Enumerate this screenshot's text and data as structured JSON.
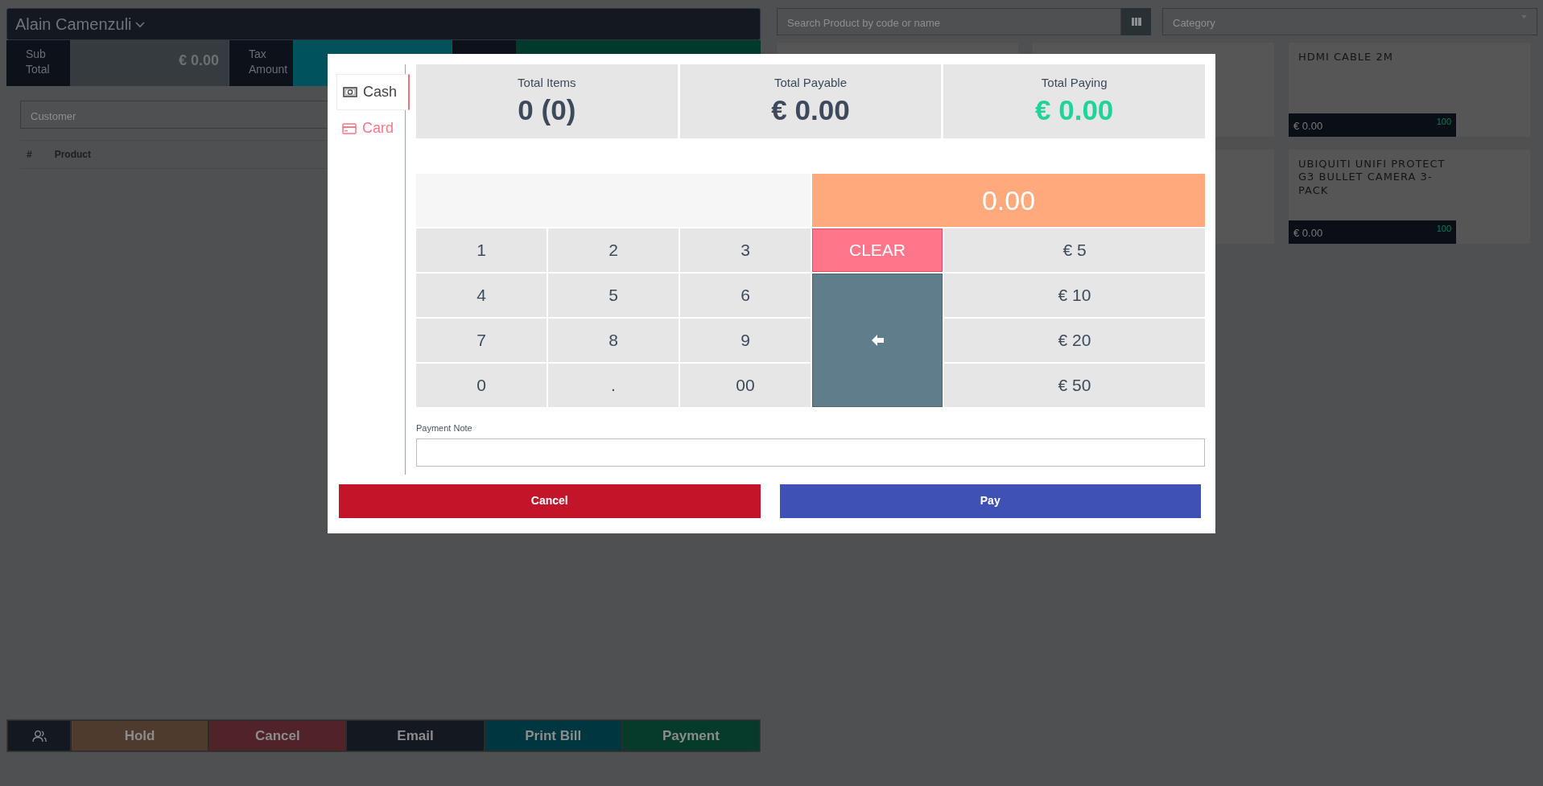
{
  "header": {
    "user": "Alain Camenzuli"
  },
  "totals": [
    {
      "label": "Sub Total",
      "value": "€ 0.00"
    },
    {
      "label": "Tax Amount"
    }
  ],
  "customer": {
    "placeholder": "Customer"
  },
  "cart_table": {
    "columns": [
      "#",
      "Product"
    ]
  },
  "actions": [
    {
      "kind": "icon",
      "color": "#141821"
    },
    {
      "kind": "text",
      "label": "Hold",
      "color": "#4f3a2e"
    },
    {
      "kind": "text",
      "label": "Cancel",
      "color": "#4f2327"
    },
    {
      "kind": "text",
      "label": "Email",
      "color": "#141821"
    },
    {
      "kind": "text",
      "label": "Print Bill",
      "color": "#00363f"
    },
    {
      "kind": "text",
      "label": "Payment",
      "color": "#063a2a"
    }
  ],
  "search": {
    "placeholder": "Search Product by code or name"
  },
  "category": {
    "placeholder": "Category"
  },
  "product_rows": [
    [
      {
        "kind": "covered"
      },
      {
        "kind": "covered"
      },
      {
        "kind": "product",
        "name": "HDMI CABLE 2M",
        "price": "€ 0.00",
        "stock": "100"
      }
    ],
    [
      {
        "kind": "covered"
      },
      {
        "kind": "product",
        "name": "UBIQUITI UNIFI PROTECT G3 BULLET CAMERA 3-PACK",
        "price": "€ 0.00",
        "stock": "100"
      }
    ]
  ],
  "payment_modal": {
    "methods": [
      {
        "kind": "cash",
        "label": "Cash",
        "selected": true
      },
      {
        "kind": "card",
        "label": "Card",
        "selected": false
      }
    ],
    "stats": [
      {
        "label": "Total Items",
        "value": "0 (0)",
        "kind": "plain"
      },
      {
        "label": "Total Payable",
        "value": "€ 0.00",
        "kind": "plain"
      },
      {
        "label": "Total Paying",
        "value": "€ 0.00",
        "kind": "paying"
      }
    ],
    "display": "0.00",
    "keys": [
      {
        "kind": "digit",
        "label": "1"
      },
      {
        "kind": "digit",
        "label": "2"
      },
      {
        "kind": "digit",
        "label": "3"
      },
      {
        "kind": "clear",
        "label": "CLEAR"
      },
      {
        "kind": "amount",
        "label": "€ 5"
      },
      {
        "kind": "digit",
        "label": "4"
      },
      {
        "kind": "digit",
        "label": "5"
      },
      {
        "kind": "digit",
        "label": "6"
      },
      {
        "kind": "backspace"
      },
      {
        "kind": "amount",
        "label": "€ 10"
      },
      {
        "kind": "digit",
        "label": "7"
      },
      {
        "kind": "digit",
        "label": "8"
      },
      {
        "kind": "digit",
        "label": "9"
      },
      {
        "kind": "amount",
        "label": "€ 20"
      },
      {
        "kind": "digit",
        "label": "0"
      },
      {
        "kind": "digit",
        "label": "."
      },
      {
        "kind": "digit",
        "label": "00"
      },
      {
        "kind": "amount",
        "label": "€ 50"
      }
    ],
    "note_label": "Payment Note",
    "buttons": [
      {
        "kind": "cancel",
        "label": "Cancel"
      },
      {
        "kind": "pay",
        "label": "Pay"
      }
    ]
  }
}
